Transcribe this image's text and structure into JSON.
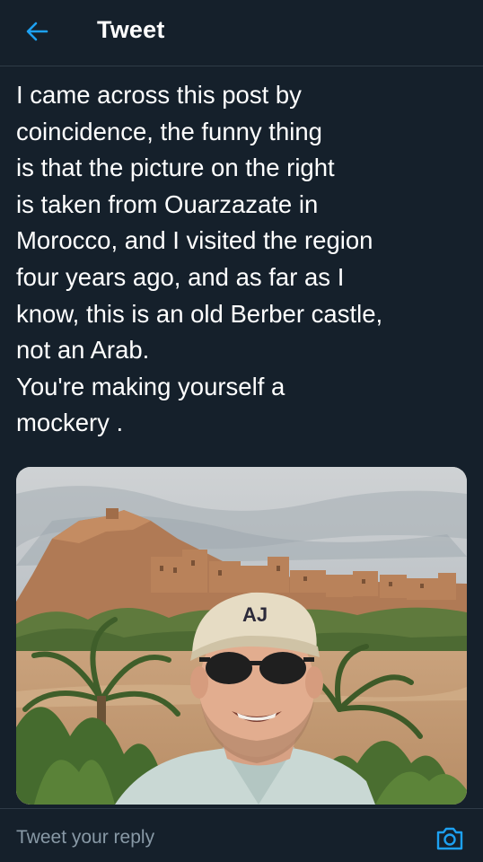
{
  "header": {
    "title": "Tweet",
    "back_icon": "arrow-left-icon",
    "accent_color": "#1da1f2"
  },
  "tweet": {
    "text_lines": [
      "I came across this post by",
      "coincidence, the funny thing",
      "is that the picture on the right",
      "is taken from Ouarzazate in",
      "Morocco, and I visited the region",
      "four years ago, and as far as I",
      "know, this is an old Berber castle,",
      "not an Arab.",
      "You're making yourself a",
      "mockery ."
    ],
    "image": {
      "cap_text": "AJ"
    }
  },
  "reply": {
    "placeholder": "Tweet your reply",
    "camera_icon": "camera-icon"
  },
  "colors": {
    "background": "#15202b",
    "text": "#ffffff",
    "muted": "#8899a6",
    "accent": "#1da1f2"
  }
}
